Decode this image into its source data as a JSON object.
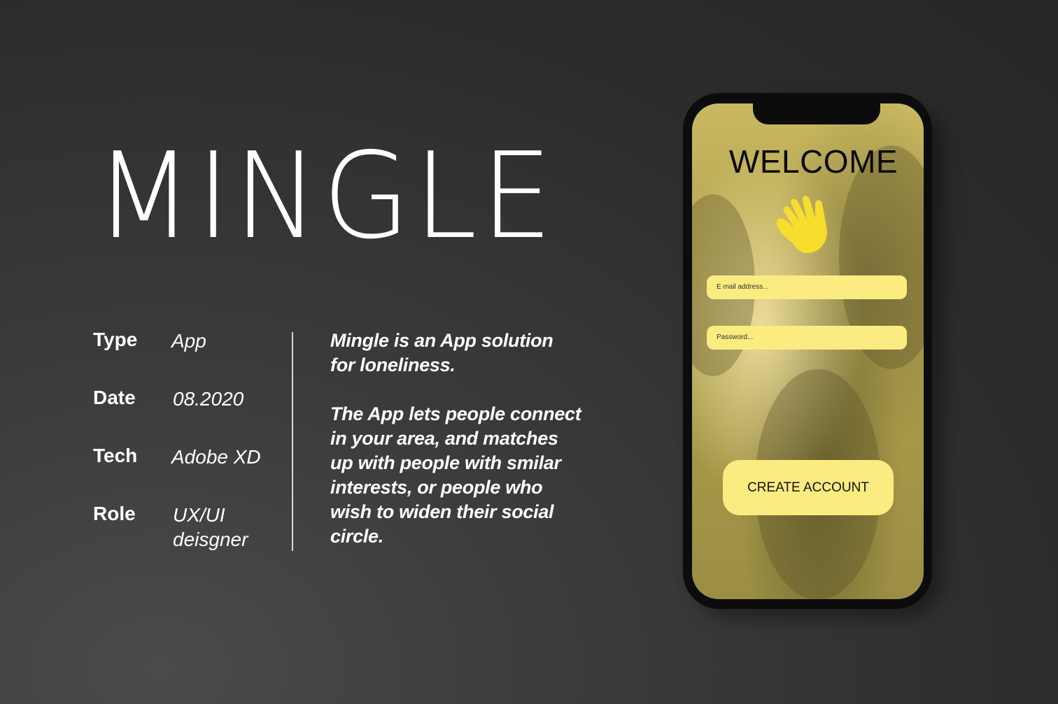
{
  "app_title": "MINGLE",
  "meta": [
    {
      "key": "Type",
      "value": "App"
    },
    {
      "key": "Date",
      "value": "08.2020"
    },
    {
      "key": "Tech",
      "value": "Adobe XD"
    },
    {
      "key": "Role",
      "value": "UX/UI deisgner"
    }
  ],
  "description": {
    "intro": "Mingle is an App solution for loneliness.",
    "body": "The App lets people connect in your area, and matches up with people with smilar interests, or people who wish to widen their social circle."
  },
  "phone": {
    "welcome": "WELCOME",
    "wave_icon": "waving-hand-icon",
    "email_placeholder": "E mail address...",
    "password_placeholder": "Password...",
    "create_account_label": "CREATE ACCOUNT",
    "accent_color": "#faec80",
    "icon_color": "#f7dd2e"
  }
}
